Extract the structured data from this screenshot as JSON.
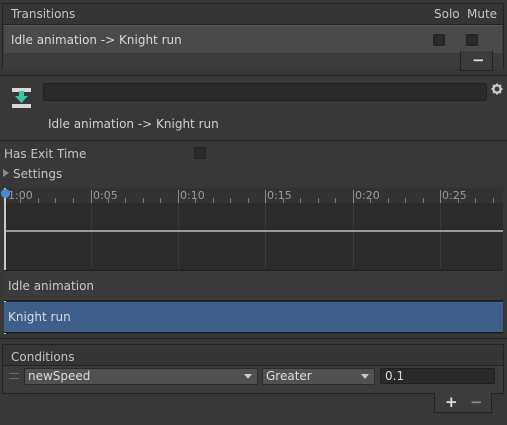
{
  "transitions": {
    "header": "Transitions",
    "solo_label": "Solo",
    "mute_label": "Mute",
    "row_label": "Idle animation -> Knight run",
    "remove_button": "−"
  },
  "inspector": {
    "icon": "transition-download-icon",
    "title": "Idle animation -> Knight run",
    "gear_icon": "gear-icon"
  },
  "settings": {
    "has_exit_time_label": "Has Exit Time",
    "has_exit_time_checked": false,
    "settings_label": "Settings"
  },
  "timeline": {
    "ticks": [
      "1:00",
      "0:05",
      "0:10",
      "0:15",
      "0:20",
      "0:25"
    ],
    "tracks": [
      "Idle animation",
      "Knight run"
    ]
  },
  "conditions": {
    "header": "Conditions",
    "parameter": "newSpeed",
    "mode": "Greater",
    "value": "0.1",
    "add_button": "+",
    "remove_button": "−"
  },
  "colors": {
    "accent": "#3e5f8a",
    "panel": "#3c3c3c",
    "background": "#383838"
  }
}
